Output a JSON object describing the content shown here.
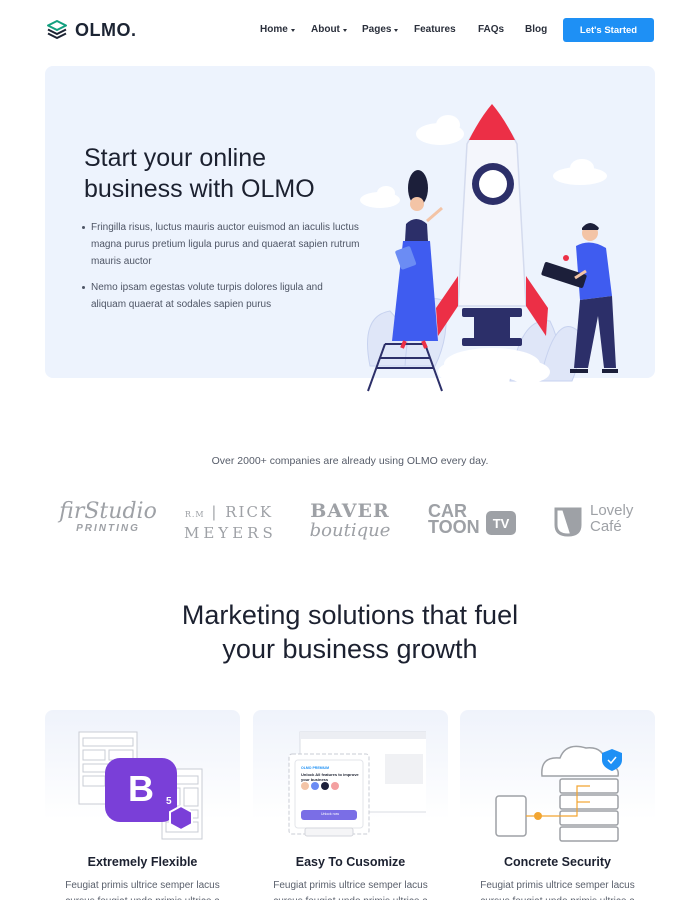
{
  "header": {
    "brand": "OLMO.",
    "nav": [
      {
        "label": "Home",
        "dropdown": true
      },
      {
        "label": "About",
        "dropdown": true
      },
      {
        "label": "Pages",
        "dropdown": true
      },
      {
        "label": "Features",
        "dropdown": false
      },
      {
        "label": "FAQs",
        "dropdown": false
      },
      {
        "label": "Blog",
        "dropdown": false
      }
    ],
    "cta_label": "Let's Started"
  },
  "hero": {
    "title": "Start your online business with OLMO",
    "bullets": [
      "Fringilla risus, luctus mauris auctor euismod an iaculis luctus magna purus pretium ligula purus and quaerat sapien rutrum mauris auctor",
      "Nemo ipsam egestas volute turpis dolores ligula and aliquam quaerat at sodales sapien purus"
    ]
  },
  "companies": {
    "text": "Over 2000+ companies are already using OLMO every day.",
    "logos": {
      "firstudio": {
        "line1": "firStudio",
        "line2": "PRINTING"
      },
      "rick": {
        "prefix": "R.M",
        "line1": "RICK",
        "line2": "MEYERS"
      },
      "baver": {
        "line1": "BAVER",
        "line2": "boutique"
      },
      "cartoon": {
        "line1": "CAR",
        "line2": "TOON",
        "badge": "TV"
      },
      "lovely": {
        "line1": "Lovely",
        "line2": "Café"
      }
    }
  },
  "section": {
    "title_line1": "Marketing solutions that fuel",
    "title_line2": "your business growth"
  },
  "features": [
    {
      "title": "Extremely Flexible",
      "text": "Feugiat primis ultrice semper lacus cursus feugiat undo primis ultrice a"
    },
    {
      "title": "Easy To Cusomize",
      "text": "Feugiat primis ultrice semper lacus cursus feugiat undo primis ultrice a"
    },
    {
      "title": "Concrete Security",
      "text": "Feugiat primis ultrice semper lacus cursus feugiat undo primis ultrice a"
    }
  ],
  "mockup": {
    "eyebrow": "OLMO PREMIUM",
    "headline": "Unlock All features to improve your business",
    "button": "Unlock now",
    "badge": "5"
  },
  "colors": {
    "accent": "#1e90f5",
    "hero_bg": "#edf3fd",
    "bootstrap_purple": "#7a3fd8",
    "heading": "#1c2130"
  }
}
